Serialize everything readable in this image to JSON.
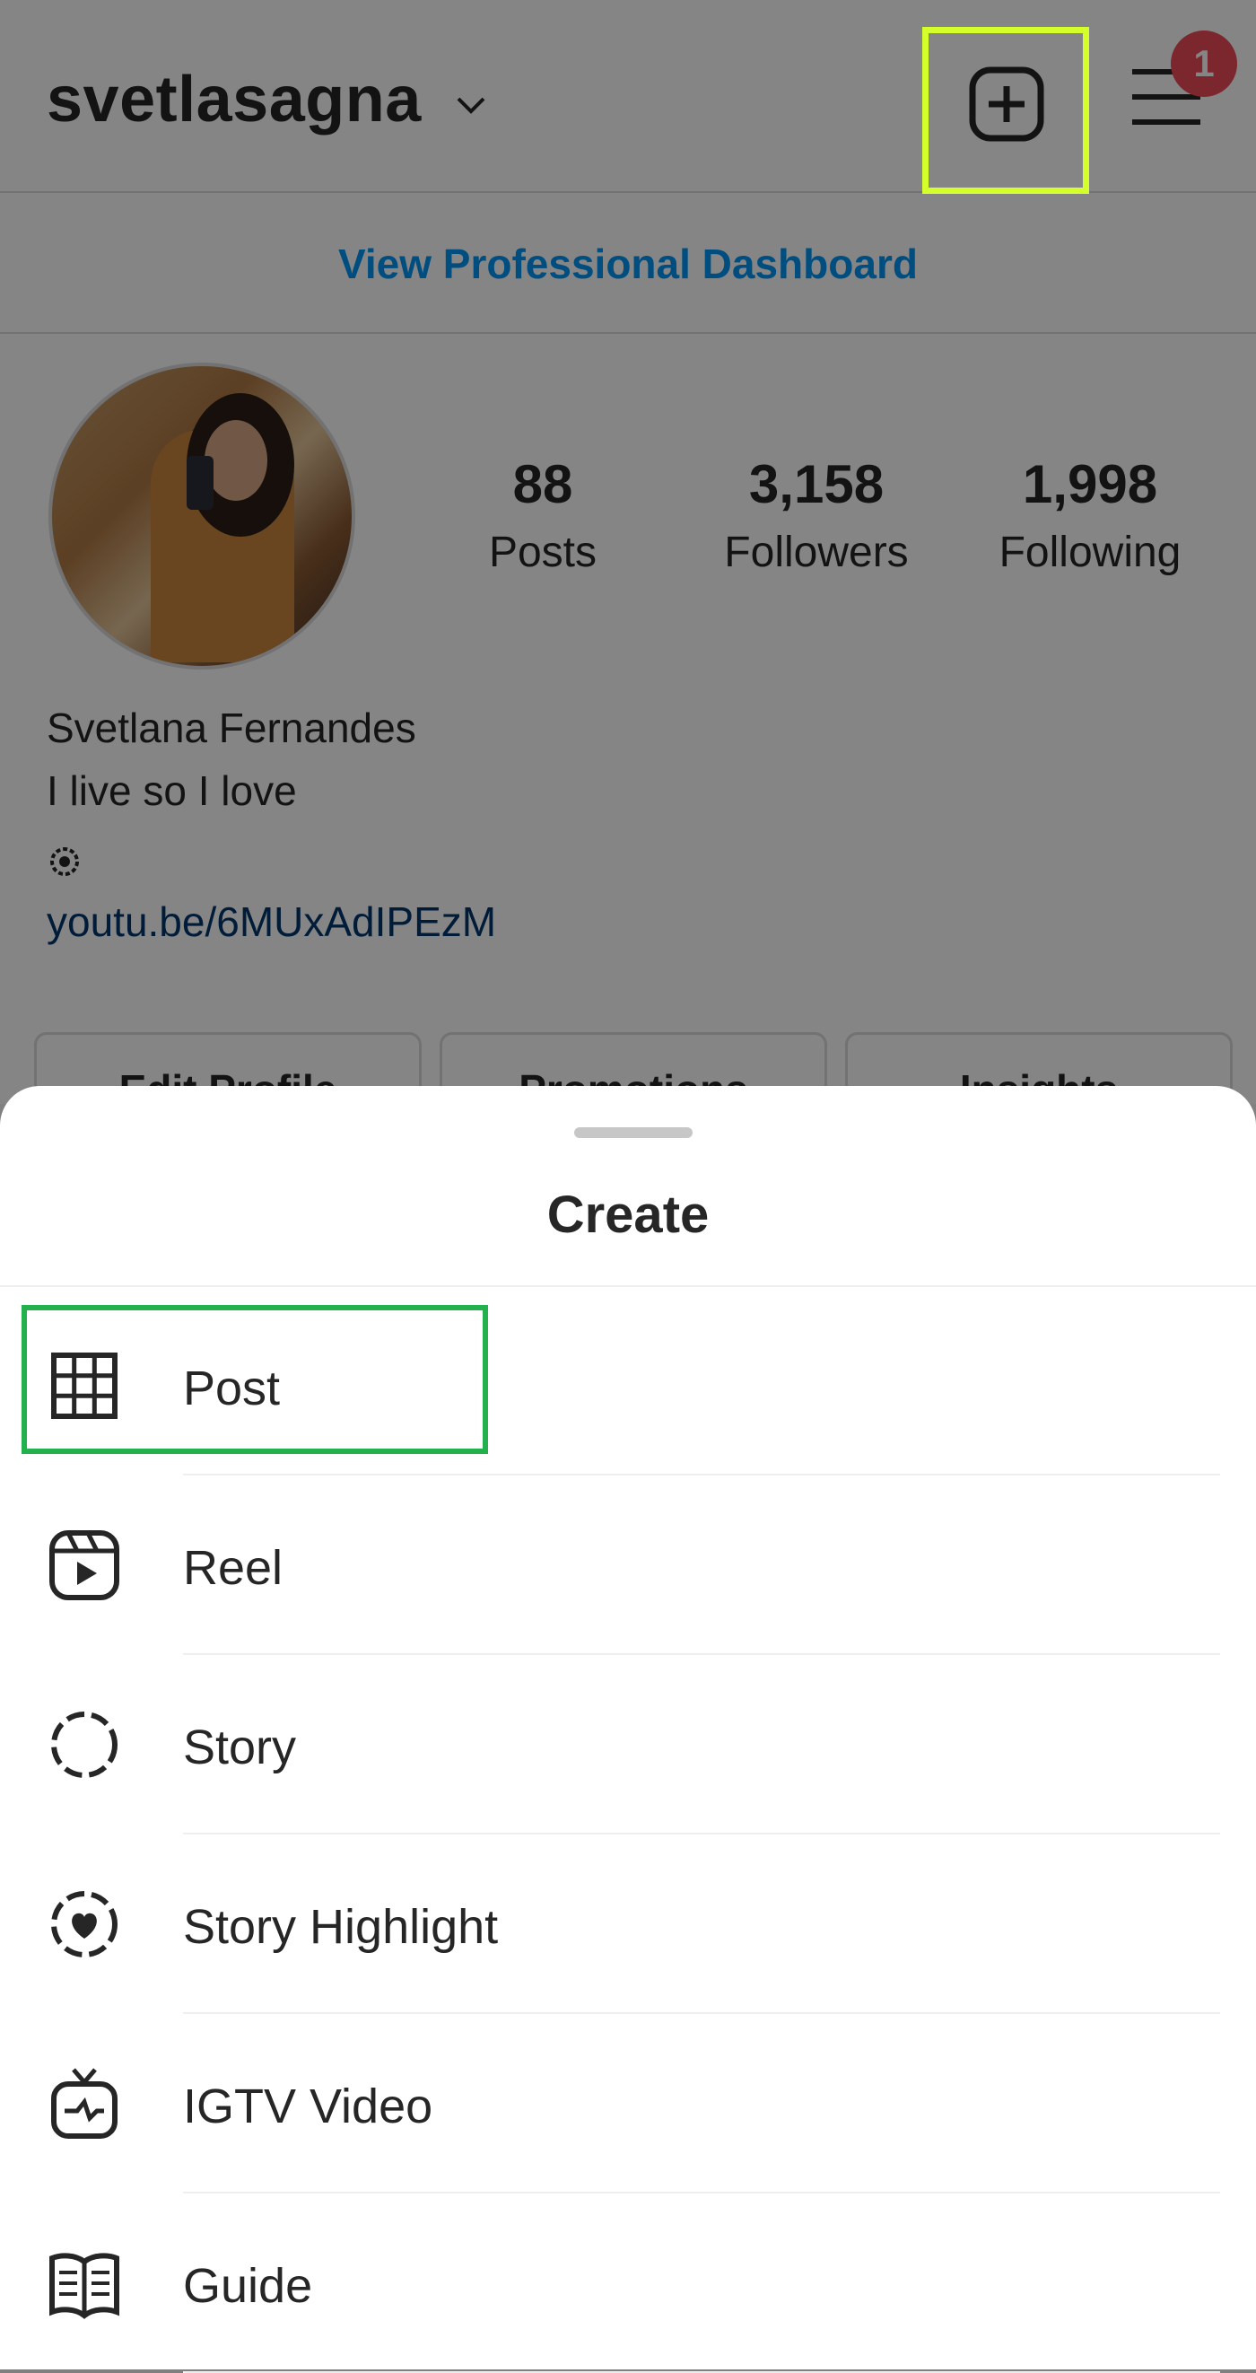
{
  "profile": {
    "username": "svetlasagna",
    "notification_count": "1",
    "dashboard_link": "View Professional Dashboard",
    "stats": [
      {
        "value": "88",
        "label": "Posts"
      },
      {
        "value": "3,158",
        "label": "Followers"
      },
      {
        "value": "1,998",
        "label": "Following"
      }
    ],
    "full_name": "Svetlana Fernandes",
    "bio": "I live so I love",
    "link": "youtu.be/6MUxAdIPEzM",
    "buttons": [
      "Edit Profile",
      "Promotions",
      "Insights"
    ]
  },
  "sheet": {
    "title": "Create",
    "items": [
      {
        "label": "Post",
        "icon": "grid-icon"
      },
      {
        "label": "Reel",
        "icon": "reel-icon"
      },
      {
        "label": "Story",
        "icon": "story-icon"
      },
      {
        "label": "Story Highlight",
        "icon": "story-highlight-icon"
      },
      {
        "label": "IGTV Video",
        "icon": "igtv-icon"
      },
      {
        "label": "Guide",
        "icon": "guide-icon"
      }
    ]
  },
  "colors": {
    "link_blue": "#0095f6",
    "badge_red": "#ed4956",
    "highlight_yellow_green": "#d4ff2a",
    "highlight_green": "#22b14c"
  }
}
